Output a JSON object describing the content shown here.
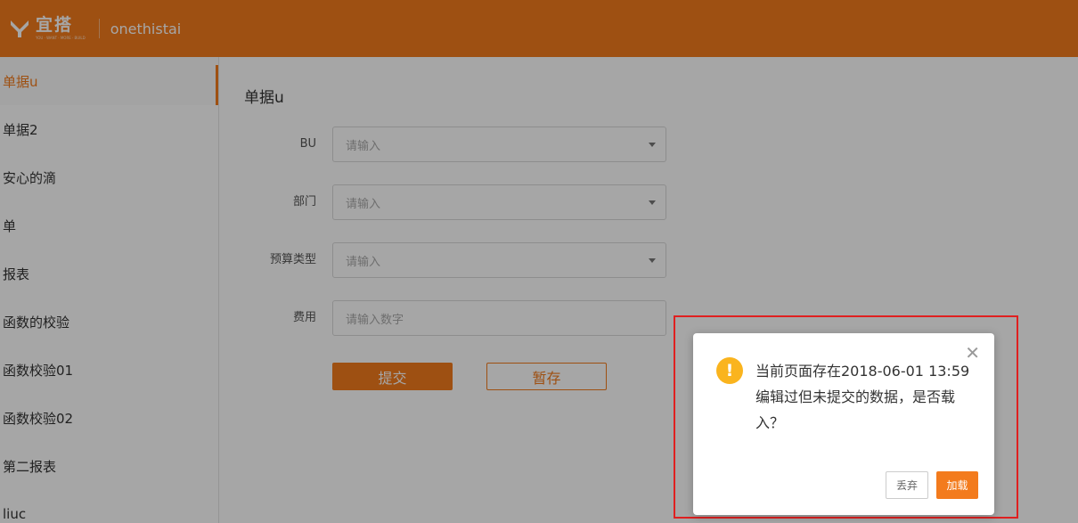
{
  "header": {
    "logo_text": "宜搭",
    "logo_sub": "YOU · WANT · MORE · BUILD",
    "app_name": "onethistai",
    "colors": {
      "brand": "#f37b1d"
    }
  },
  "sidebar": {
    "items": [
      {
        "label": "单据u",
        "active": true
      },
      {
        "label": "单据2"
      },
      {
        "label": "安心的滴"
      },
      {
        "label": "单"
      },
      {
        "label": "报表"
      },
      {
        "label": "函数的校验"
      },
      {
        "label": "函数校验01"
      },
      {
        "label": "函数校验02"
      },
      {
        "label": "第二报表"
      },
      {
        "label": "liuc"
      }
    ]
  },
  "form": {
    "title": "单据u",
    "fields": [
      {
        "label": "BU",
        "placeholder": "请输入",
        "type": "select"
      },
      {
        "label": "部门",
        "placeholder": "请输入",
        "type": "select"
      },
      {
        "label": "预算类型",
        "placeholder": "请输入",
        "type": "select"
      },
      {
        "label": "费用",
        "placeholder": "请输入数字",
        "type": "number"
      }
    ],
    "submit_label": "提交",
    "save_label": "暂存"
  },
  "modal": {
    "message": "当前页面存在2018-06-01 13:59编辑过但未提交的数据，是否载入？",
    "discard_label": "丢弃",
    "load_label": "加载",
    "icon": "warning-icon",
    "colors": {
      "warning": "#fab41e",
      "highlight": "#e02020"
    }
  }
}
